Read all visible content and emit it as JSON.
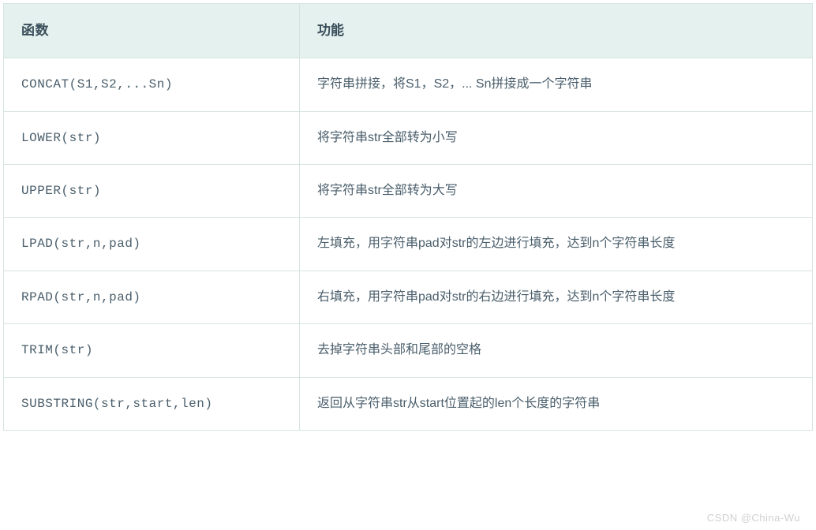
{
  "table": {
    "headers": {
      "func": "函数",
      "desc": "功能"
    },
    "rows": [
      {
        "func": "CONCAT(S1,S2,...Sn)",
        "desc": "字符串拼接，将S1，S2，... Sn拼接成一个字符串"
      },
      {
        "func": "LOWER(str)",
        "desc": "将字符串str全部转为小写"
      },
      {
        "func": "UPPER(str)",
        "desc": "将字符串str全部转为大写"
      },
      {
        "func": "LPAD(str,n,pad)",
        "desc": "左填充，用字符串pad对str的左边进行填充，达到n个字符串长度"
      },
      {
        "func": "RPAD(str,n,pad)",
        "desc": "右填充，用字符串pad对str的右边进行填充，达到n个字符串长度"
      },
      {
        "func": "TRIM(str)",
        "desc": "去掉字符串头部和尾部的空格"
      },
      {
        "func": "SUBSTRING(str,start,len)",
        "desc": "返回从字符串str从start位置起的len个长度的字符串"
      }
    ]
  },
  "watermark": "CSDN @China-Wu"
}
